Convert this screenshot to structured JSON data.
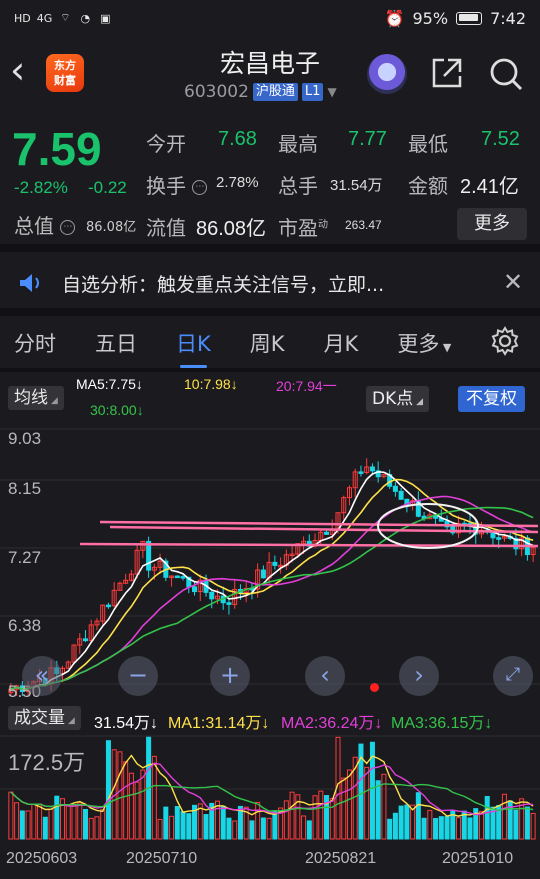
{
  "status": {
    "left_icons": [
      "HD",
      "4G",
      "wifi-icon",
      "wechat-icon",
      "app-icon"
    ],
    "battery": "95%",
    "time": "7:42"
  },
  "header": {
    "brand_line1": "东方",
    "brand_line2": "财富",
    "stock_name": "宏昌电子",
    "stock_code": "603002",
    "tag1": "沪股通",
    "tag2": "L1"
  },
  "quote": {
    "price": "7.59",
    "change_pct": "-2.82%",
    "change_amt": "-0.22",
    "open_label": "今开",
    "open": "7.68",
    "high_label": "最高",
    "high": "7.77",
    "low_label": "最低",
    "low": "7.52",
    "turnover_label": "换手",
    "turnover": "2.78%",
    "volume_label": "总手",
    "volume": "31.54万",
    "amount_label": "金额",
    "amount": "2.41亿",
    "mktcap_label": "总值",
    "mktcap": "86.08亿",
    "float_label": "流值",
    "float": "86.08亿",
    "pe_label": "市盈",
    "pe_sup": "动",
    "pe": "263.47",
    "more_button": "更多",
    "price_color": "#19c26b"
  },
  "notice": {
    "text": "自选分析：触发重点关注信号，立即..."
  },
  "tabs": {
    "items": [
      "分时",
      "五日",
      "日K",
      "周K",
      "月K"
    ],
    "active_index": 2,
    "more_label": "更多"
  },
  "ma_bar": {
    "selector": "均线",
    "ma5": "MA5:7.75↓",
    "ma10": "10:7.98↓",
    "ma20": "20:7.94一",
    "ma30": "30:8.00↓",
    "dk_label": "DK点",
    "fq_label": "不复权"
  },
  "price_axis": {
    "labels": [
      "9.03",
      "8.15",
      "7.27",
      "6.38",
      "5.50"
    ]
  },
  "volume_bar": {
    "selector": "成交量",
    "vol": "31.54万↓",
    "ma1": "MA1:31.14万↓",
    "ma2": "MA2:36.24万↓",
    "ma3": "MA3:36.15万↓",
    "axis_max": "172.5万"
  },
  "dates": [
    "20250603",
    "20250710",
    "20250821",
    "20251010"
  ],
  "colors": {
    "up": "#ff3b3b",
    "down": "#19d6e6",
    "ma5": "#ffffff",
    "ma10": "#ffe14a",
    "ma20": "#e23fd9",
    "ma30": "#33c34a",
    "accent": "#4a8dff"
  }
}
